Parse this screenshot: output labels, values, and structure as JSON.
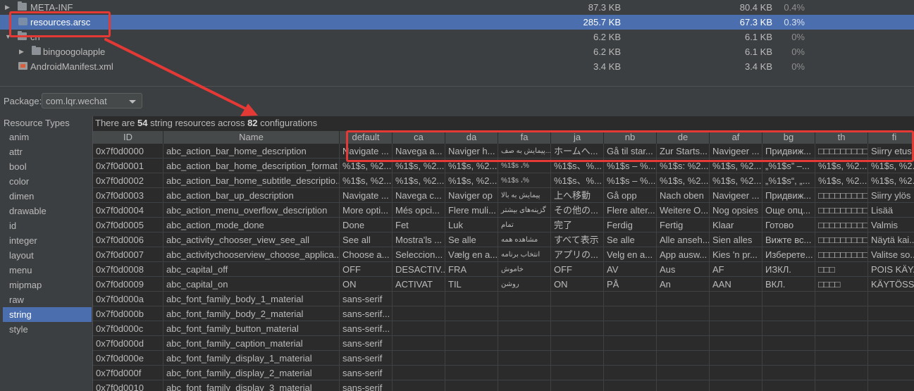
{
  "tree": {
    "rows": [
      {
        "icon": "folder-icon",
        "name": "META-INF",
        "size": "87.3 KB",
        "dl_size": "80.4 KB",
        "percent": "0.4%",
        "expand": "collapsed"
      },
      {
        "icon": "arsc-file-icon",
        "name": "resources.arsc",
        "size": "285.7 KB",
        "dl_size": "67.3 KB",
        "percent": "0.3%",
        "expand": "none",
        "selected": true
      },
      {
        "icon": "folder-icon",
        "name": "cn",
        "size": "6.2 KB",
        "dl_size": "6.1 KB",
        "percent": "0%",
        "expand": "expanded"
      },
      {
        "icon": "folder-icon",
        "name": "bingoogolapple",
        "size": "6.2 KB",
        "dl_size": "6.1 KB",
        "percent": "0%",
        "expand": "collapsed"
      },
      {
        "icon": "xml-file-icon",
        "name": "AndroidManifest.xml",
        "size": "3.4 KB",
        "dl_size": "3.4 KB",
        "percent": "0%",
        "expand": "none"
      }
    ]
  },
  "package": {
    "label": "Package:",
    "value": "com.lqr.wechat"
  },
  "resource_types": {
    "header": "Resource Types",
    "items": [
      "anim",
      "attr",
      "bool",
      "color",
      "dimen",
      "drawable",
      "id",
      "integer",
      "layout",
      "menu",
      "mipmap",
      "raw",
      "string",
      "style"
    ],
    "selected": "string"
  },
  "summary": {
    "prefix": "There are ",
    "count": "54",
    "middle": " string resources across ",
    "configs": "82",
    "suffix": " configurations"
  },
  "table": {
    "columns": [
      "ID",
      "Name",
      "default",
      "ca",
      "da",
      "fa",
      "ja",
      "nb",
      "de",
      "af",
      "bg",
      "th",
      "fi"
    ],
    "rows": [
      [
        "0x7f0d0000",
        "abc_action_bar_home_description",
        "Navigate ...",
        "Navega a...",
        "Naviger h...",
        "پیمایش به صف...",
        "ホームへ...",
        "Gå til star...",
        "Zur Starts...",
        "Navigeer ...",
        "Придвиж...",
        "□□□□□□□□□□",
        "Siirry etus..."
      ],
      [
        "0x7f0d0001",
        "abc_action_bar_home_description_format",
        "%1$s, %2...",
        "%1$s, %2...",
        "%1$s, %2...",
        "%1$s ،%",
        "%1$s、%...",
        "%1$s – %...",
        "%1$s: %2...",
        "%1$s, %2...",
        "„%1$s” –...",
        "%1$s, %2...",
        "%1$s, %2..."
      ],
      [
        "0x7f0d0002",
        "abc_action_bar_home_subtitle_descriptio...",
        "%1$s, %2...",
        "%1$s, %2...",
        "%1$s, %2...",
        "%1$s ،%",
        "%1$s、%...",
        "%1$s – %...",
        "%1$s, %2...",
        "%1$s, %2...",
        "„%1$s“, „...",
        "%1$s, %2...",
        "%1$s, %2..."
      ],
      [
        "0x7f0d0003",
        "abc_action_bar_up_description",
        "Navigate ...",
        "Navega c...",
        "Naviger op",
        "پیمایش به بالا",
        "上へ移動",
        "Gå opp",
        "Nach oben",
        "Navigeer ...",
        "Придвиж...",
        "□□□□□□□□□□",
        "Siirry ylös"
      ],
      [
        "0x7f0d0004",
        "abc_action_menu_overflow_description",
        "More opti...",
        "Més opci...",
        "Flere muli...",
        "گزینه‌های بیشتر",
        "その他の...",
        "Flere alter...",
        "Weitere O...",
        "Nog opsies",
        "Още опц...",
        "□□□□□□□□□□",
        "Lisää"
      ],
      [
        "0x7f0d0005",
        "abc_action_mode_done",
        "Done",
        "Fet",
        "Luk",
        "تمام",
        "完了",
        "Ferdig",
        "Fertig",
        "Klaar",
        "Готово",
        "□□□□□□□□□□",
        "Valmis"
      ],
      [
        "0x7f0d0006",
        "abc_activity_chooser_view_see_all",
        "See all",
        "Mostra'ls ...",
        "Se alle",
        "مشاهده همه",
        "すべて表示",
        "Se alle",
        "Alle anseh...",
        "Sien alles",
        "Вижте вс...",
        "□□□□□□□□□□",
        "Näytä kai..."
      ],
      [
        "0x7f0d0007",
        "abc_activitychooserview_choose_applica...",
        "Choose a...",
        "Seleccion...",
        "Vælg en a...",
        "انتخاب برنامه",
        "アプリの...",
        "Velg en a...",
        "App ausw...",
        "Kies 'n pr...",
        "Изберете...",
        "□□□□□□□□□□",
        "Valitse so..."
      ],
      [
        "0x7f0d0008",
        "abc_capital_off",
        "OFF",
        "DESACTIV...",
        "FRA",
        "خاموش",
        "OFF",
        "AV",
        "Aus",
        "AF",
        "ИЗКЛ.",
        "□□□",
        "POIS KÄY..."
      ],
      [
        "0x7f0d0009",
        "abc_capital_on",
        "ON",
        "ACTIVAT",
        "TIL",
        "روشن",
        "ON",
        "PÅ",
        "An",
        "AAN",
        "ВКЛ.",
        "□□□□",
        "KÄYTÖSSÄ"
      ],
      [
        "0x7f0d000a",
        "abc_font_family_body_1_material",
        "sans-serif",
        "",
        "",
        "",
        "",
        "",
        "",
        "",
        "",
        "",
        ""
      ],
      [
        "0x7f0d000b",
        "abc_font_family_body_2_material",
        "sans-serif...",
        "",
        "",
        "",
        "",
        "",
        "",
        "",
        "",
        "",
        ""
      ],
      [
        "0x7f0d000c",
        "abc_font_family_button_material",
        "sans-serif...",
        "",
        "",
        "",
        "",
        "",
        "",
        "",
        "",
        "",
        ""
      ],
      [
        "0x7f0d000d",
        "abc_font_family_caption_material",
        "sans-serif",
        "",
        "",
        "",
        "",
        "",
        "",
        "",
        "",
        "",
        ""
      ],
      [
        "0x7f0d000e",
        "abc_font_family_display_1_material",
        "sans-serif",
        "",
        "",
        "",
        "",
        "",
        "",
        "",
        "",
        "",
        ""
      ],
      [
        "0x7f0d000f",
        "abc_font_family_display_2_material",
        "sans-serif",
        "",
        "",
        "",
        "",
        "",
        "",
        "",
        "",
        "",
        ""
      ],
      [
        "0x7f0d0010",
        "abc_font_family_display_3_material",
        "sans-serif",
        "",
        "",
        "",
        "",
        "",
        "",
        "",
        "",
        "",
        ""
      ]
    ]
  },
  "colors": {
    "selection": "#4b6eaf",
    "annotation": "#e53935",
    "background": "#2b2b2b",
    "panel": "#3c3f41"
  }
}
